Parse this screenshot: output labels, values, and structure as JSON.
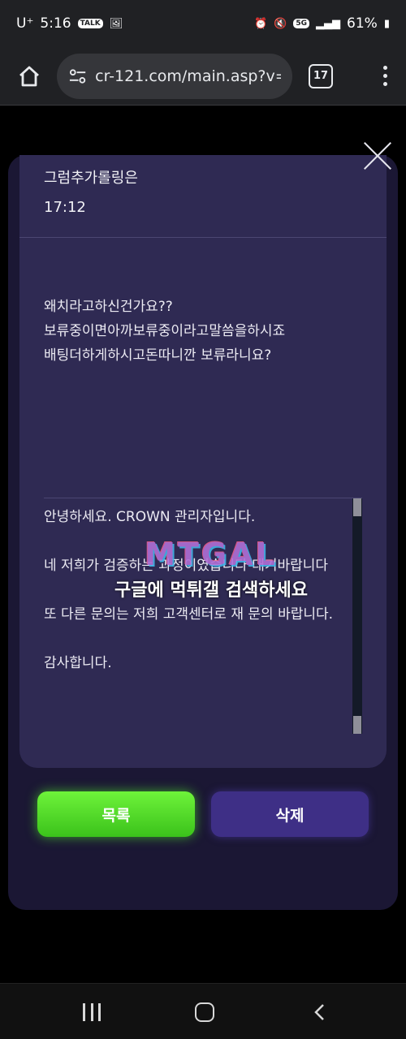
{
  "status_bar": {
    "carrier": "U⁺",
    "time": "5:16",
    "battery": "61%",
    "network": "5G"
  },
  "browser": {
    "url": "cr-121.com/main.asp?v=",
    "tab_count": "17"
  },
  "post": {
    "title": "그럼추가롤링은",
    "time": "17:12",
    "body_lines": [
      "왜치라고하신건가요??",
      "보류중이면아까보류중이라고말씀을하시죠",
      "배팅더하게하시고돈따니깐 보류라니요?"
    ]
  },
  "reply": {
    "lines": [
      "안녕하세요. CROWN 관리자입니다.",
      "네 저희가 검증하는 과정이였습니다 대기바랍니다",
      "또 다른 문의는 저희 고객센터로 재 문의 바랍니다.",
      "감사합니다."
    ]
  },
  "watermark": {
    "logo": "MTGAL",
    "text": "구글에 먹튀갤 검색하세요"
  },
  "buttons": {
    "list": "목록",
    "delete": "삭제"
  },
  "colors": {
    "modal_bg": "#1b1734",
    "card_bg": "#2f2a53",
    "list_button": "#4fd624",
    "delete_button": "#3e2f86"
  },
  "icons": {
    "home": "home-icon",
    "site_info": "tune-icon",
    "close": "close-icon",
    "menu": "more-vert-icon"
  }
}
